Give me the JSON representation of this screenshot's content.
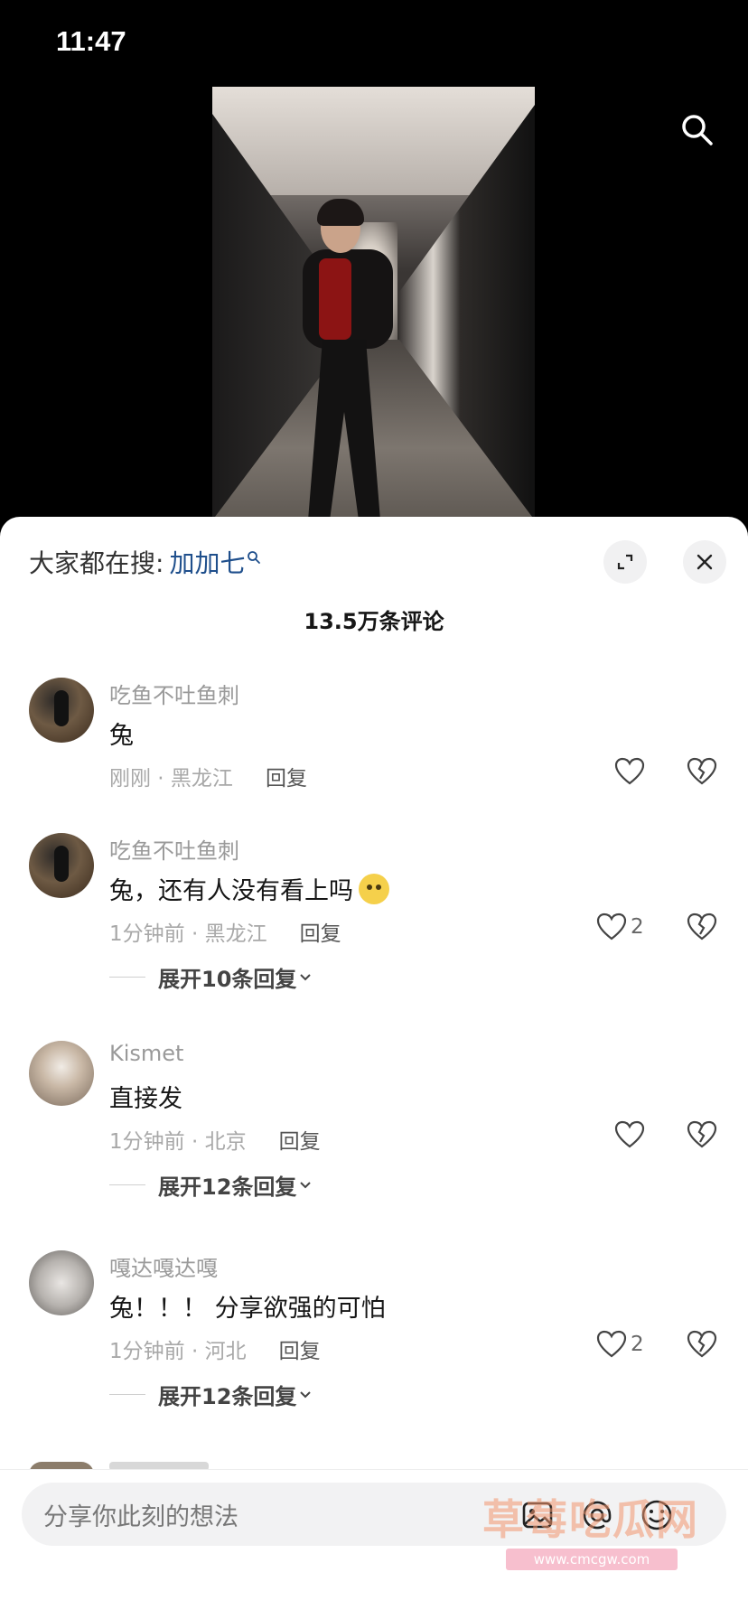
{
  "status_bar": {
    "time": "11:47"
  },
  "trending": {
    "prefix": "大家都在搜:",
    "keyword": "加加七"
  },
  "comments_count": "13.5万条评论",
  "comments": [
    {
      "user": "吃鱼不吐鱼刺",
      "text": "兔",
      "time": "刚刚 · 黑龙江",
      "reply": "回复",
      "likes": ""
    },
    {
      "user": "吃鱼不吐鱼刺",
      "text": "兔，还有人没有看上吗",
      "time": "1分钟前 · 黑龙江",
      "reply": "回复",
      "likes": "2",
      "expand": "展开10条回复"
    },
    {
      "user": "Kismet",
      "text": "直接发",
      "time": "1分钟前 · 北京",
      "reply": "回复",
      "likes": "",
      "expand": "展开12条回复"
    },
    {
      "user": "嘎达嘎达嘎",
      "text": "兔！！！ 分享欲强的可怕",
      "time": "1分钟前 · 河北",
      "reply": "回复",
      "likes": "2",
      "expand": "展开12条回复"
    }
  ],
  "input": {
    "placeholder": "分享你此刻的想法"
  },
  "watermark": {
    "text": "草莓吃瓜网",
    "url": "www.cmcgw.com"
  }
}
